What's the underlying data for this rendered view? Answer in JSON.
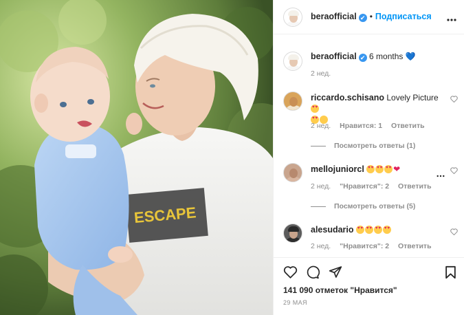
{
  "header": {
    "username": "beraofficial",
    "verified_mark": "✔",
    "separator": "•",
    "follow_label": "Подписаться",
    "more_icon": "more-horizontal-icon"
  },
  "caption": {
    "username": "beraofficial",
    "verified_mark": "✔",
    "text": "6 months",
    "emoji": "💙",
    "time": "2 нед."
  },
  "comments": [
    {
      "username": "riccardo.schisano",
      "text": "Lovely Picture",
      "time": "2 нед.",
      "likes": "Нравится: 1",
      "reply": "Ответить",
      "view_replies": "Посмотреть ответы (1)"
    },
    {
      "username": "mellojuniorcl",
      "text": "",
      "time": "2 нед.",
      "likes": "\"Нравится\": 2",
      "reply": "Ответить",
      "view_replies": "Посмотреть ответы (5)"
    },
    {
      "username": "alesudario",
      "text": "",
      "time": "2 нед.",
      "likes": "\"Нравится\": 2",
      "reply": "Ответить"
    }
  ],
  "footer": {
    "likes": "141 090 отметок \"Нравится\"",
    "date": "29 мая"
  },
  "colors": {
    "accent": "#0095f6",
    "verified": "#3897f0",
    "muted": "#8e8e8e",
    "text": "#262626"
  }
}
